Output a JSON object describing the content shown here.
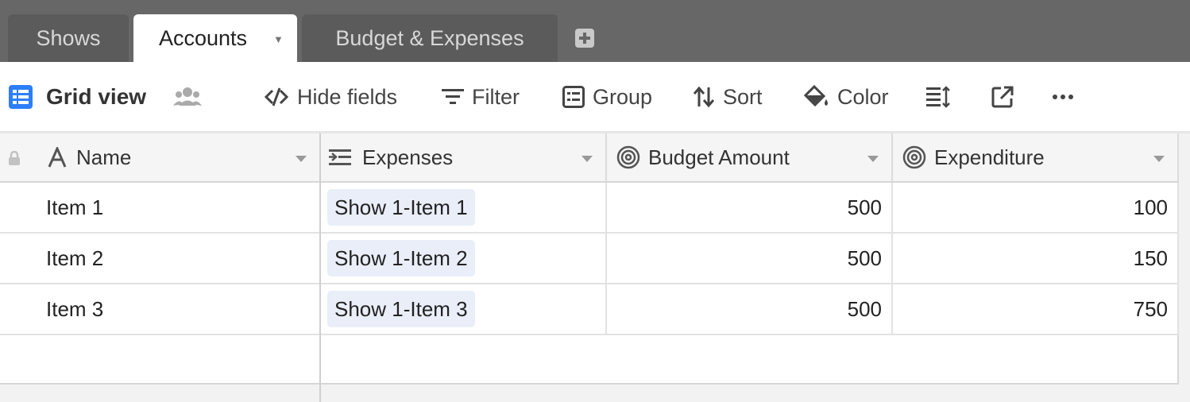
{
  "tabs": [
    {
      "label": "Shows"
    },
    {
      "label": "Accounts"
    },
    {
      "label": "Budget & Expenses"
    }
  ],
  "toolbar": {
    "view_name": "Grid view",
    "hide_fields": "Hide fields",
    "filter": "Filter",
    "group": "Group",
    "sort": "Sort",
    "color": "Color"
  },
  "columns": [
    {
      "label": "Name"
    },
    {
      "label": "Expenses"
    },
    {
      "label": "Budget Amount"
    },
    {
      "label": "Expenditure"
    }
  ],
  "rows": [
    {
      "name": "Item 1",
      "expense": "Show 1-Item 1",
      "budget": "500",
      "expenditure": "100"
    },
    {
      "name": "Item 2",
      "expense": "Show 1-Item 2",
      "budget": "500",
      "expenditure": "150"
    },
    {
      "name": "Item 3",
      "expense": "Show 1-Item 3",
      "budget": "500",
      "expenditure": "750"
    }
  ],
  "colors": {
    "accent": "#2d7ff9",
    "tabbar": "#676767",
    "chip": "#e9eef9"
  }
}
